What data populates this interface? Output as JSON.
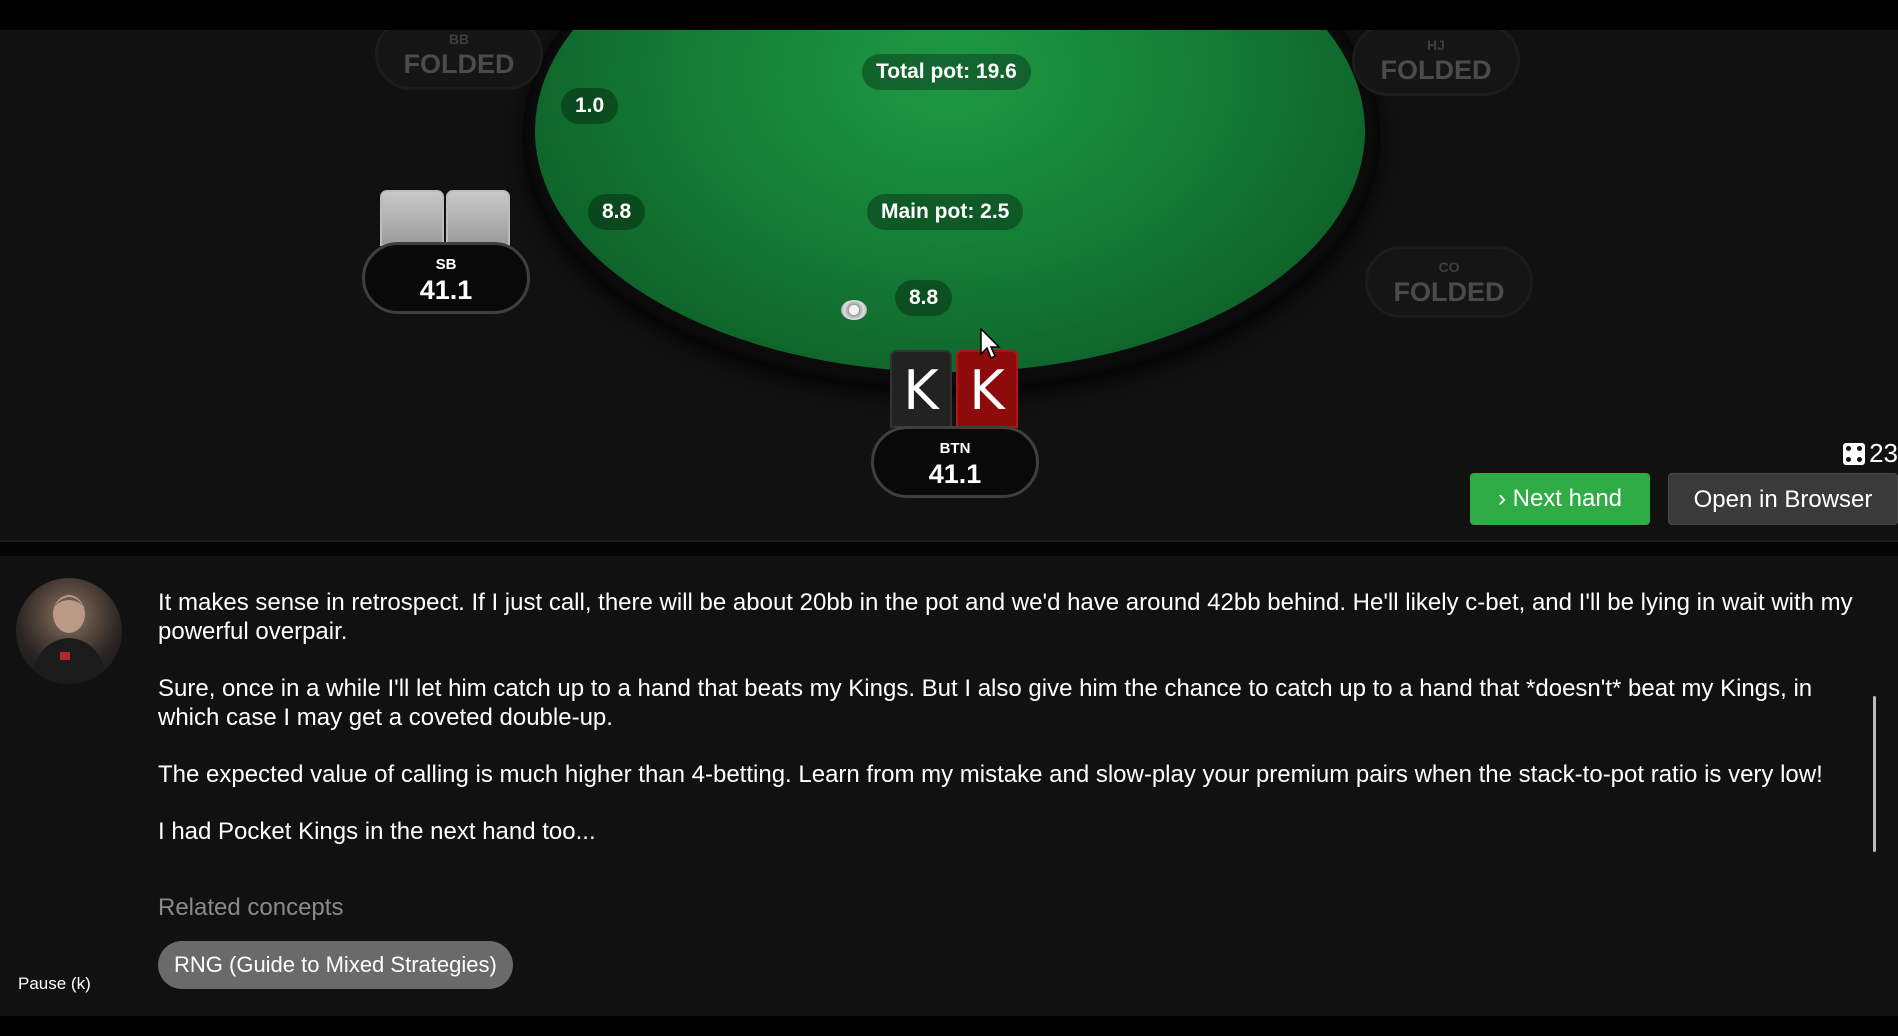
{
  "table": {
    "total_pot": "Total pot: 19.6",
    "main_pot": "Main pot: 2.5",
    "bets": [
      "1.0",
      "8.8",
      "8.8"
    ]
  },
  "seats": {
    "bb": {
      "pos": "BB",
      "status": "FOLDED"
    },
    "hj": {
      "pos": "HJ",
      "status": "FOLDED"
    },
    "co": {
      "pos": "CO",
      "status": "FOLDED"
    },
    "sb": {
      "pos": "SB",
      "stack": "41.1"
    },
    "btn": {
      "pos": "BTN",
      "stack": "41.1"
    }
  },
  "hero_cards": [
    "K",
    "K"
  ],
  "dice_counter": "23",
  "buttons": {
    "next_hand": "› Next hand",
    "open_in_browser": "Open in Browser"
  },
  "commentary": {
    "paragraphs": [
      "It makes sense in retrospect. If I just call, there will be about 20bb in the pot and we'd have around 42bb behind. He'll likely c-bet, and I'll be lying in wait with my powerful overpair.",
      "Sure, once in a while I'll let him catch up to a hand that beats my Kings. But I also give him the chance to catch up to a hand that *doesn't* beat my Kings, in which case I may get a coveted double-up.",
      "The expected value of calling is much higher than 4-betting. Learn from my mistake and slow-play your premium pairs when the stack-to-pot ratio is very low!",
      "I had Pocket Kings in the next hand too..."
    ],
    "related_label": "Related concepts",
    "related_tags": [
      "RNG (Guide to Mixed Strategies)"
    ]
  },
  "player_controls": {
    "pause": "Pause (k)"
  },
  "colors": {
    "felt": "#147c35",
    "next_button": "#2fac46",
    "red_card": "#8e0b0b"
  }
}
